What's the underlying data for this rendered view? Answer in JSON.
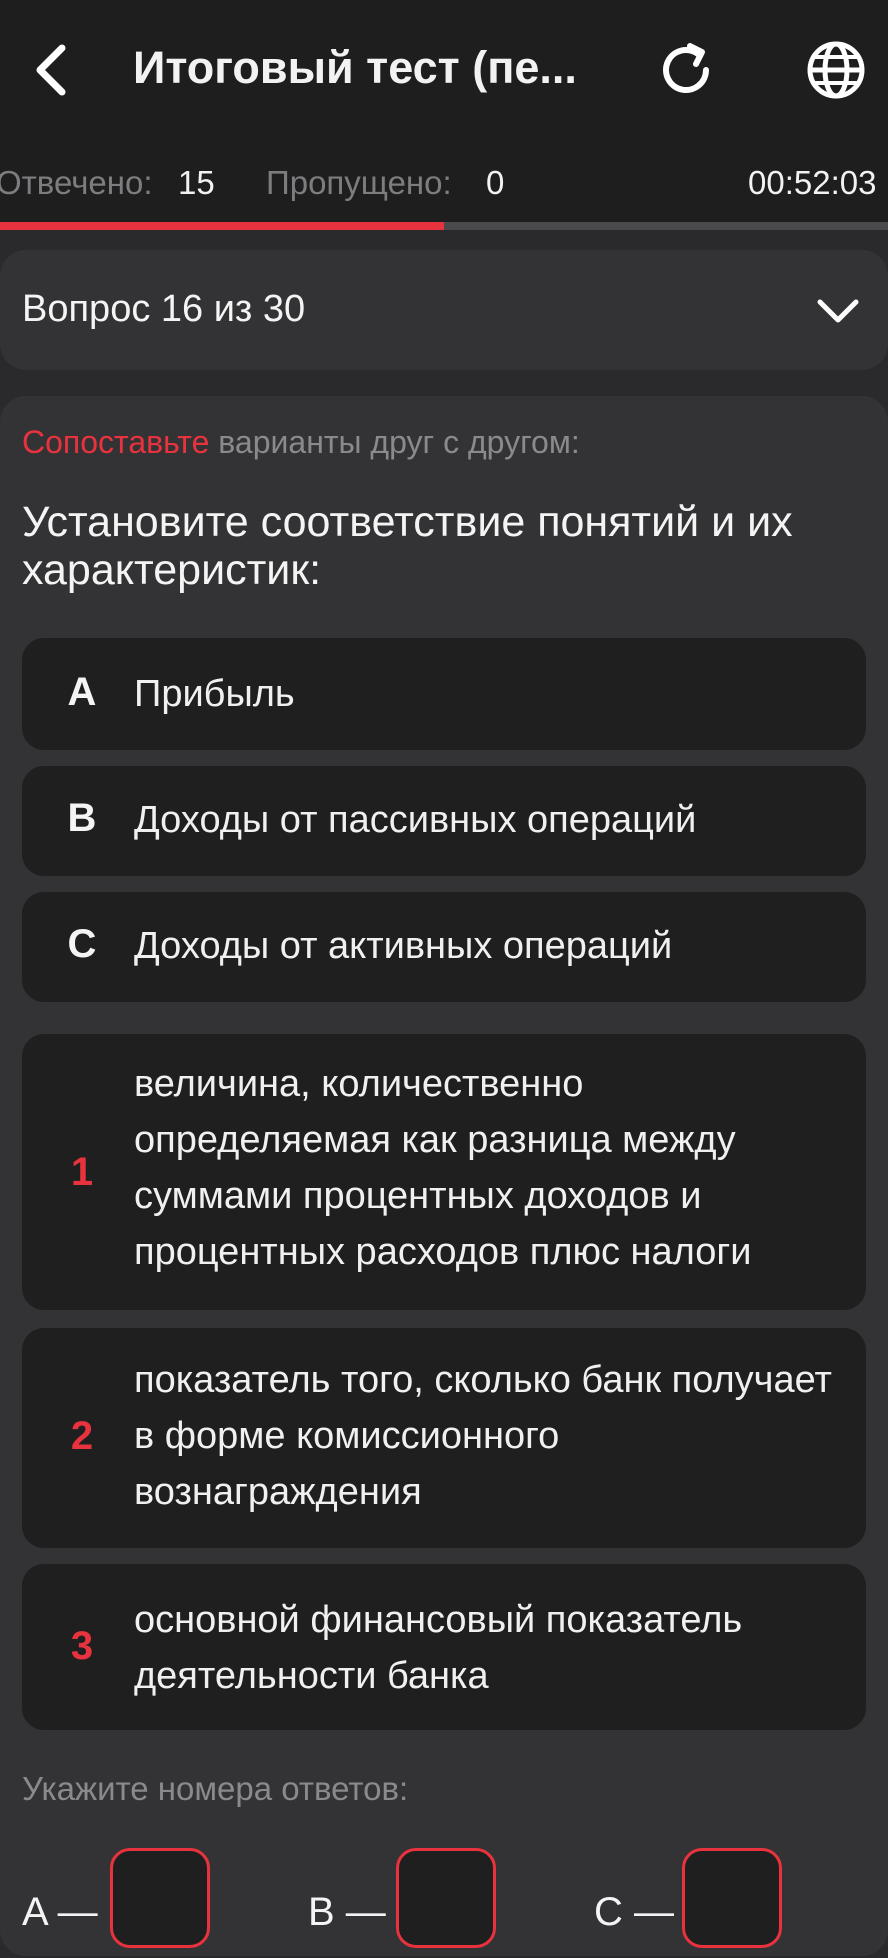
{
  "header": {
    "title": "Итоговый тест (пе..."
  },
  "stats": {
    "answered_label": "Отвечено:",
    "answered_value": "15",
    "skipped_label": "Пропущено:",
    "skipped_value": "0",
    "timer": "00:52:03"
  },
  "progress": {
    "fraction": 0.5,
    "color": "#e8333e"
  },
  "question_selector": {
    "label": "Вопрос 16 из 30"
  },
  "question": {
    "instruction_accent": "Сопоставьте",
    "instruction_rest": " варианты друг с другом:",
    "text": "Установите соответствие понятий и их характеристик:"
  },
  "concepts": [
    {
      "key": "A",
      "text": "Прибыль"
    },
    {
      "key": "B",
      "text": "Доходы от пассивных операций"
    },
    {
      "key": "C",
      "text": "Доходы от активных операций"
    }
  ],
  "definitions": [
    {
      "key": "1",
      "text": "величина, количественно определяемая как разница между суммами процентных доходов и процентных расходов плюс налоги"
    },
    {
      "key": "2",
      "text": "показатель того, сколько банк получает в форме комиссионного вознаграждения"
    },
    {
      "key": "3",
      "text": "основной финансовый показатель деятельности банка"
    }
  ],
  "answers": {
    "label": "Укажите номера ответов:",
    "items": [
      {
        "letter": "A —",
        "value": ""
      },
      {
        "letter": "B —",
        "value": ""
      },
      {
        "letter": "C —",
        "value": ""
      }
    ]
  },
  "colors": {
    "accent": "#e8333e",
    "background": "#2a2a2c",
    "header": "#1e1e1f",
    "option_bg": "#1f1f20"
  },
  "icons": [
    "back-arrow-icon",
    "reload-icon",
    "globe-icon",
    "chevron-down-icon"
  ]
}
